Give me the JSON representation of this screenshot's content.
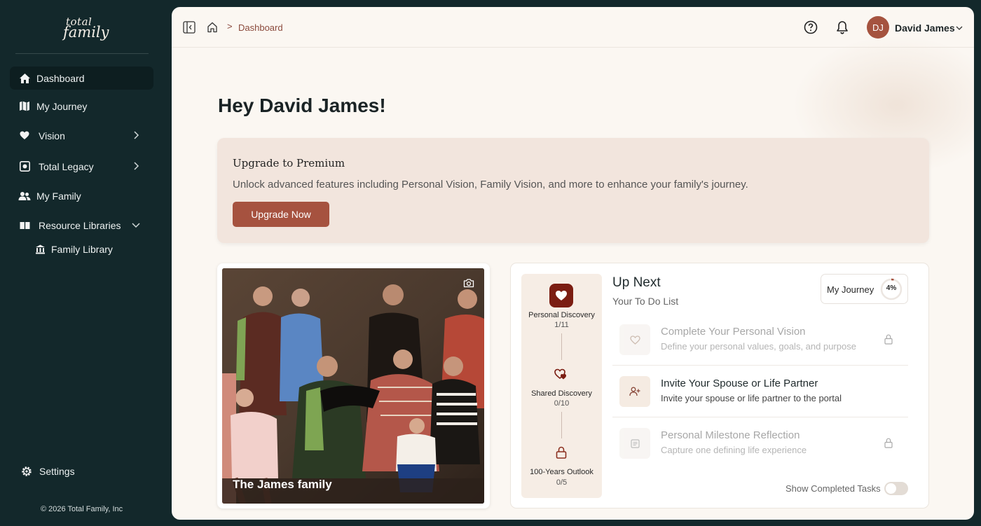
{
  "brand": {
    "logo_line1": "total",
    "logo_line2": "family"
  },
  "sidebar": {
    "items": [
      {
        "label": "Dashboard",
        "icon": "home-icon",
        "active": true
      },
      {
        "label": "My Journey",
        "icon": "map-icon"
      },
      {
        "label": "Vision",
        "icon": "heart-icon",
        "expandable": true
      },
      {
        "label": "Total Legacy",
        "icon": "vault-icon",
        "expandable": true
      },
      {
        "label": "My Family",
        "icon": "users-icon"
      },
      {
        "label": "Resource Libraries",
        "icon": "book-icon",
        "expanded": true
      }
    ],
    "sub_items": [
      {
        "label": "Family Library",
        "icon": "library-icon"
      }
    ],
    "settings_label": "Settings",
    "copyright": "© 2026 Total Family, Inc"
  },
  "topbar": {
    "breadcrumb_sep": ">",
    "breadcrumb": "Dashboard",
    "avatar_initials": "DJ",
    "user_name": "David James"
  },
  "main": {
    "greeting": "Hey David James!",
    "premium": {
      "title": "Upgrade to Premium",
      "description": "Unlock advanced features including Personal Vision, Family Vision, and more to enhance your family's journey.",
      "button": "Upgrade Now"
    },
    "photo": {
      "caption": "The James family"
    },
    "up_next": {
      "title": "Up Next",
      "subtitle": "Your To Do List",
      "journey_label": "My Journey",
      "journey_percent": "4%",
      "journey_progress": 0.04,
      "steps": [
        {
          "label": "Personal Discovery",
          "count": "1/11"
        },
        {
          "label": "Shared Discovery",
          "count": "0/10"
        },
        {
          "label": "100-Years Outlook",
          "count": "0/5"
        }
      ],
      "tasks": [
        {
          "title": "Complete Your Personal Vision",
          "description": "Define your personal values, goals, and purpose",
          "locked": true,
          "icon": "heart-icon"
        },
        {
          "title": "Invite Your Spouse or Life Partner",
          "description": "Invite your spouse or life partner to the portal",
          "locked": false,
          "icon": "user-plus-icon"
        },
        {
          "title": "Personal Milestone Reflection",
          "description": "Capture one defining life experience",
          "locked": true,
          "icon": "document-icon"
        }
      ],
      "show_completed_label": "Show Completed Tasks",
      "show_completed": false
    }
  },
  "colors": {
    "sidebar_bg": "#13282b",
    "accent": "#a6523f",
    "accent_dark": "#7b1d12",
    "page_bg": "#fbf7f2",
    "premium_bg": "#f2e5dd"
  }
}
